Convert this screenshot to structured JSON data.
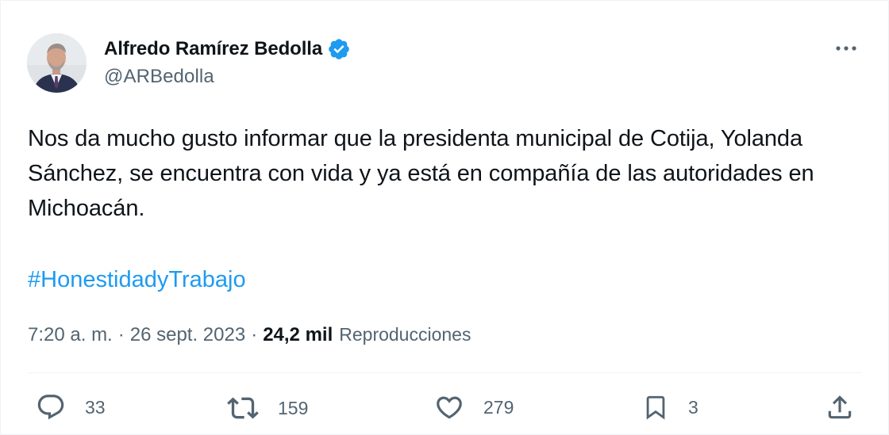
{
  "author": {
    "display_name": "Alfredo Ramírez Bedolla",
    "handle": "@ARBedolla",
    "verified_icon": "verified-badge-icon",
    "avatar_icon": "profile-avatar"
  },
  "menu": {
    "more_icon": "more-options-icon"
  },
  "tweet": {
    "text": "Nos da mucho gusto informar que la presidenta municipal de Cotija, Yolanda Sánchez, se encuentra con vida y ya está en compañía de las autoridades en Michoacán.",
    "hashtag": "#HonestidadyTrabajo"
  },
  "meta": {
    "time": "7:20 a. m.",
    "separator": "·",
    "date": "26 sept. 2023",
    "views_count": "24,2 mil",
    "views_label": "Reproducciones"
  },
  "actions": {
    "replies": "33",
    "retweets": "159",
    "likes": "279",
    "bookmarks": "3"
  },
  "colors": {
    "link": "#1d9bf0",
    "secondary_text": "#536471",
    "primary_text": "#0f1419",
    "verified": "#1d9bf0",
    "divider": "#eff3f4"
  }
}
